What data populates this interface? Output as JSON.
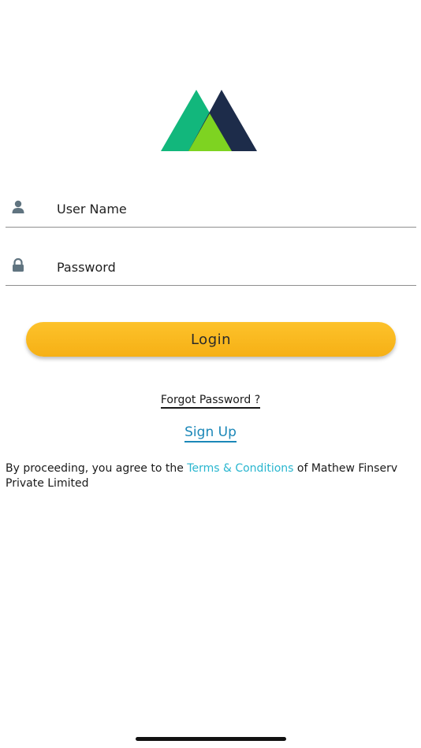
{
  "logo": {
    "icon": "mountain-logo",
    "colors": {
      "left_peak": "#12b77c",
      "right_peak": "#1d2c4a",
      "center": "#7ed321"
    }
  },
  "form": {
    "username": {
      "icon": "user-icon",
      "placeholder": "User Name",
      "value": ""
    },
    "password": {
      "icon": "lock-icon",
      "placeholder": "Password",
      "value": ""
    },
    "login_label": "Login"
  },
  "links": {
    "forgot_password": "Forgot Password ?",
    "sign_up": "Sign Up"
  },
  "terms": {
    "prefix": "By proceeding, you agree to the ",
    "link": "Terms & Conditions",
    "suffix": " of Mathew Finserv Private Limited"
  },
  "colors": {
    "accent": "#f9b81e",
    "link_blue": "#1b87b8",
    "terms_link": "#29b6cf",
    "icon_gray": "#607480"
  }
}
